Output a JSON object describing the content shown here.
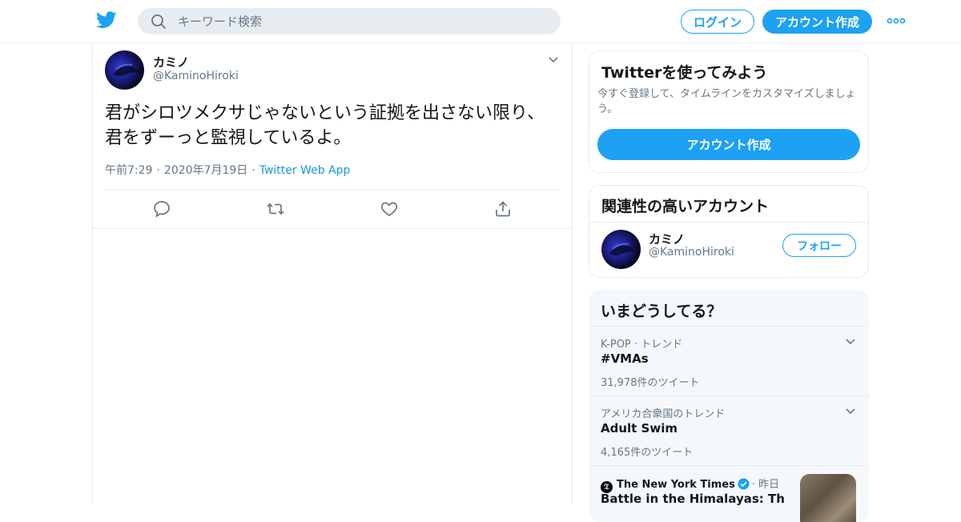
{
  "header": {
    "logo": "twitter-bird-icon",
    "search_placeholder": "キーワード検索",
    "login_label": "ログイン",
    "signup_label": "アカウント作成",
    "more_icon": "more-dots-icon",
    "accent": "#1da1f2"
  },
  "tweet": {
    "author_name": "カミノ",
    "author_handle": "@KaminoHiroki",
    "text": "君がシロツメクサじゃないという証拠を出さない限り、君をずーっと監視しているよ。",
    "time": "午前7:29",
    "date": "2020年7月19日",
    "separator": "·",
    "source": "Twitter Web App",
    "actions": [
      "reply-icon",
      "retweet-icon",
      "like-icon",
      "share-icon"
    ]
  },
  "signup_card": {
    "title": "Twitterを使ってみよう",
    "description": "今すぐ登録して、タイムラインをカスタマイズしましょう。",
    "button_label": "アカウント作成"
  },
  "related_card": {
    "title": "関連性の高いアカウント",
    "account_name": "カミノ",
    "account_handle": "@KaminoHiroki",
    "follow_label": "フォロー"
  },
  "trends_card": {
    "title": "いまどうしてる？",
    "trends": [
      {
        "context": "K-POP · トレンド",
        "name": "#VMAs",
        "count": "31,978件のツイート"
      },
      {
        "context": "アメリカ合衆国のトレンド",
        "name": "Adult Swim",
        "count": "4,165件のツイート"
      }
    ],
    "news": {
      "source": "The New York Times",
      "time": "· 昨日",
      "headline": "Battle in the Himalayas: The"
    }
  }
}
